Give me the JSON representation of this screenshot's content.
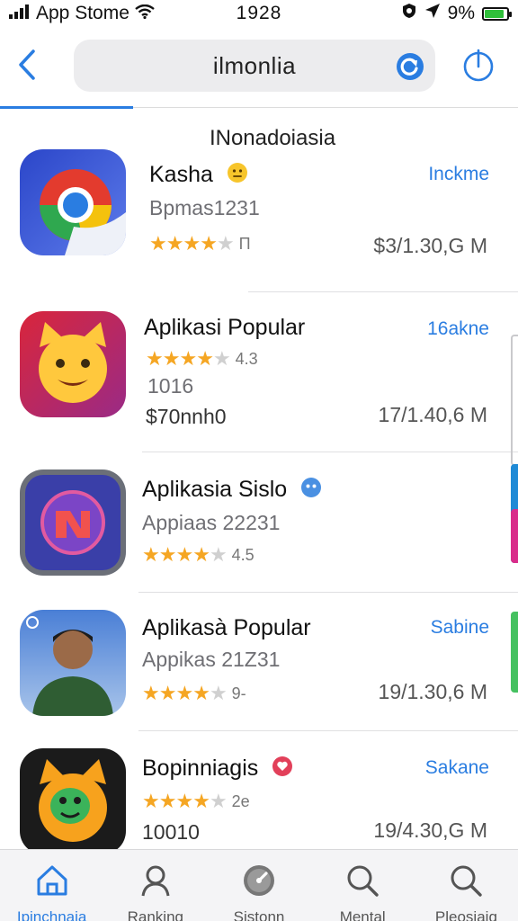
{
  "status_bar": {
    "carrier": "App Stome",
    "time": "1928",
    "battery": "9%",
    "battery_level_percent": 90
  },
  "nav": {
    "back_icon": "chevron-left-icon",
    "search_value": "ilmonlia",
    "refresh_icon": "refresh-icon",
    "share_icon": "share-icon"
  },
  "section": {
    "title": "INonadoiasia"
  },
  "apps": [
    {
      "name": "Kasha",
      "subtitle": "Bpmas1231",
      "rating_value": "Π",
      "action": "Inckme",
      "size": "$3/1.30,G M"
    },
    {
      "name": "Aplikasi Popular",
      "rating_value": "4.3",
      "line2": "1016",
      "line3": "$70nnh0",
      "action": "16akne",
      "size": "17/1.40,6 M"
    },
    {
      "name": "Aplikasia Sislo",
      "subtitle": "Appiaas 22231",
      "rating_value": "4.5",
      "action": "",
      "size": ""
    },
    {
      "name": "Aplikasà Popular",
      "subtitle": "Appikas 21Z31",
      "rating_value": "9-",
      "action": "Sabine",
      "size": "19/1.30,6 M"
    },
    {
      "name": "Bopinniagis",
      "rating_value": "2e",
      "line3": "10010",
      "action": "Sakane",
      "size": "19/4.30,G M"
    }
  ],
  "stars": {
    "filled": 4,
    "total": 5
  },
  "tabs": [
    {
      "label": "Ipinchnaia",
      "icon": "home-icon",
      "active": true
    },
    {
      "label": "Ranking",
      "icon": "person-icon",
      "active": false
    },
    {
      "label": "Sistonn",
      "icon": "gauge-icon",
      "active": false
    },
    {
      "label": "Mental",
      "icon": "search-icon",
      "active": false
    },
    {
      "label": "Pleosiaiq",
      "icon": "search-icon",
      "active": false
    }
  ],
  "colors": {
    "accent": "#2a7de1",
    "star": "#f5a623"
  }
}
